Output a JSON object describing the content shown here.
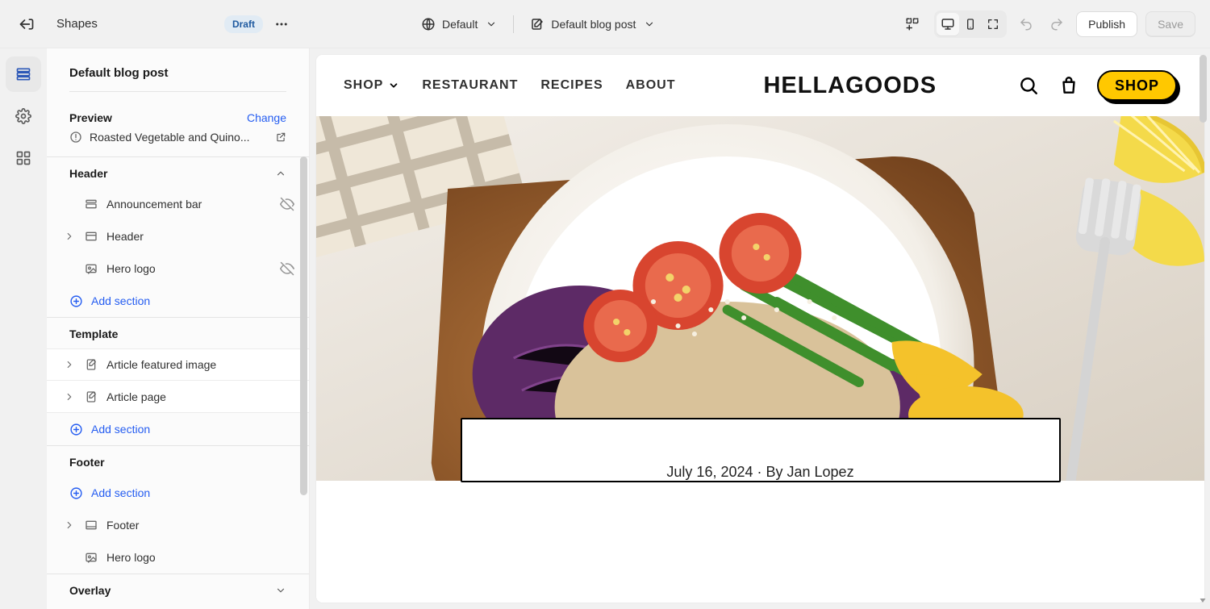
{
  "topbar": {
    "theme_name": "Shapes",
    "draft_label": "Draft",
    "default_dropdown_label": "Default",
    "template_dropdown_label": "Default blog post",
    "publish_label": "Publish",
    "save_label": "Save"
  },
  "sidebar": {
    "page_title": "Default blog post",
    "preview": {
      "label": "Preview",
      "change_label": "Change",
      "item_title": "Roasted Vegetable and Quino..."
    },
    "groups": {
      "header": {
        "title": "Header",
        "items": [
          {
            "label": "Announcement bar",
            "icon": "layout-top",
            "hidden": true
          },
          {
            "label": "Header",
            "icon": "layout-header",
            "expandable": true
          },
          {
            "label": "Hero logo",
            "icon": "image",
            "hidden": true
          }
        ],
        "add_label": "Add section"
      },
      "template": {
        "title": "Template",
        "items": [
          {
            "label": "Article featured image",
            "icon": "doc",
            "expandable": true
          },
          {
            "label": "Article page",
            "icon": "doc",
            "expandable": true
          }
        ],
        "add_label": "Add section"
      },
      "footer": {
        "title": "Footer",
        "items": [
          {
            "label": "Footer",
            "icon": "layout-header",
            "expandable": true
          },
          {
            "label": "Hero logo",
            "icon": "image"
          }
        ],
        "add_label": "Add section"
      },
      "overlay": {
        "title": "Overlay"
      }
    }
  },
  "site": {
    "nav": {
      "shop": "SHOP",
      "restaurant": "RESTAURANT",
      "recipes": "RECIPES",
      "about": "ABOUT"
    },
    "brand": "HELLAGOODS",
    "shop_cta": "SHOP",
    "article_meta": "July 16, 2024 · By Jan Lopez"
  }
}
